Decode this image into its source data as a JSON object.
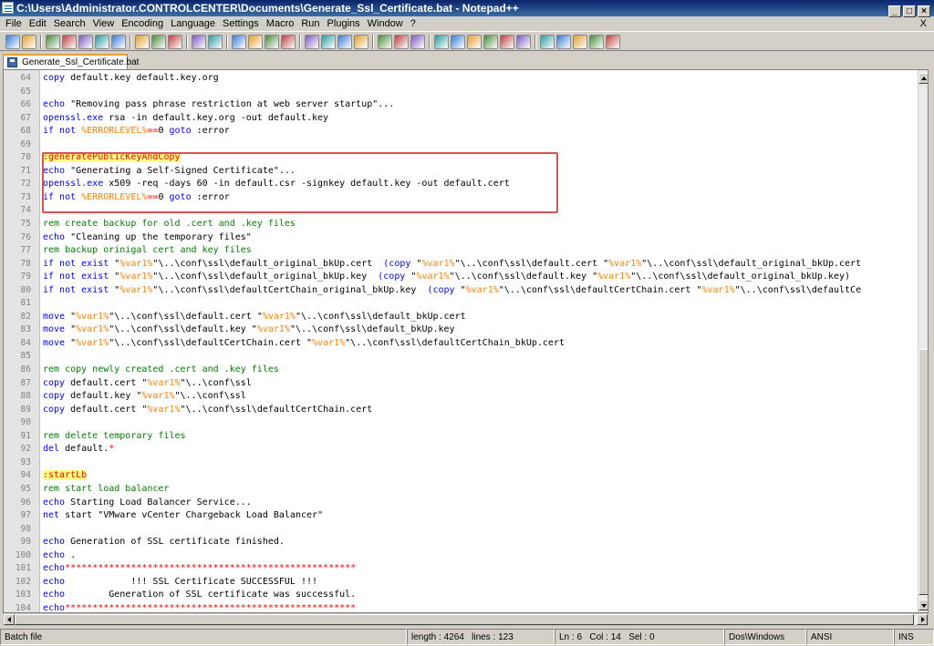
{
  "window": {
    "title": "C:\\Users\\Administrator.CONTROLCENTER\\Documents\\Generate_Ssl_Certificate.bat - Notepad++"
  },
  "menu": [
    "File",
    "Edit",
    "Search",
    "View",
    "Encoding",
    "Language",
    "Settings",
    "Macro",
    "Run",
    "Plugins",
    "Window",
    "?"
  ],
  "menu_close": "X",
  "toolbar": {
    "buttons": [
      "new",
      "open",
      "save",
      "save-all",
      "close",
      "close-all",
      "print",
      "cut",
      "copy",
      "paste",
      "undo",
      "redo",
      "find",
      "replace",
      "zoom-in",
      "zoom-out",
      "sync-vertical",
      "sync-horizontal",
      "word-wrap",
      "show-all-chars",
      "indent-guide",
      "user-lang",
      "doc-map",
      "record-macro",
      "stop-record",
      "play-macro",
      "play-multiple",
      "save-macro",
      "run",
      "trim",
      "move-up",
      "move-down",
      "hex",
      "spellcheck"
    ]
  },
  "tab": {
    "label": "Generate_Ssl_Certificate.bat"
  },
  "editor": {
    "lines": [
      {
        "n": "64",
        "t": [
          [
            "kw",
            "copy"
          ],
          [
            "",
            "default.key default.key.org"
          ]
        ]
      },
      {
        "n": "65",
        "t": []
      },
      {
        "n": "66",
        "t": [
          [
            "kw",
            "echo"
          ],
          [
            "",
            "\"Removing pass phrase restriction at web server startup\"..."
          ]
        ]
      },
      {
        "n": "67",
        "t": [
          [
            "kw",
            "openssl.exe"
          ],
          [
            "",
            "rsa -in default.key.org -out default.key"
          ]
        ]
      },
      {
        "n": "68",
        "t": [
          [
            "kw",
            "if not"
          ],
          [
            "var",
            "%ERRORLEVEL%"
          ],
          [
            "op",
            "=="
          ],
          [
            "",
            "0"
          ],
          [
            "kw",
            "goto"
          ],
          [
            "",
            ":error"
          ]
        ]
      },
      {
        "n": "69",
        "t": []
      },
      {
        "n": "70",
        "t": [
          [
            "lbl",
            ":generatePublicKeyAndCopy"
          ]
        ]
      },
      {
        "n": "71",
        "t": [
          [
            "kw",
            "echo"
          ],
          [
            "",
            "\"Generating a Self-Signed Certificate\"..."
          ]
        ]
      },
      {
        "n": "72",
        "t": [
          [
            "kw",
            "openssl.exe"
          ],
          [
            "",
            "x509 -req -days 60 -in default.csr -signkey default.key -out default.cert"
          ]
        ]
      },
      {
        "n": "73",
        "t": [
          [
            "kw",
            "if not"
          ],
          [
            "var",
            "%ERRORLEVEL%"
          ],
          [
            "op",
            "=="
          ],
          [
            "",
            "0"
          ],
          [
            "kw",
            "goto"
          ],
          [
            "",
            ":error"
          ]
        ]
      },
      {
        "n": "74",
        "t": []
      },
      {
        "n": "75",
        "t": [
          [
            "cm",
            "rem create backup for old .cert and .key files"
          ]
        ]
      },
      {
        "n": "76",
        "t": [
          [
            "kw",
            "echo"
          ],
          [
            "",
            "\"Cleaning up the temporary files\""
          ]
        ]
      },
      {
        "n": "77",
        "t": [
          [
            "cm",
            "rem backup orinigal cert and key files"
          ]
        ]
      },
      {
        "n": "78",
        "t": [
          [
            "kw",
            "if not exist"
          ],
          [
            "",
            "\""
          ],
          [
            "var",
            "%var1%"
          ],
          [
            "",
            "\"\\..\\conf\\ssl\\default_original_bkUp.cert "
          ],
          [
            "kw",
            "(copy"
          ],
          [
            "",
            "\""
          ],
          [
            "var",
            "%var1%"
          ],
          [
            "",
            "\"\\..\\conf\\ssl\\default.cert \""
          ],
          [
            "var",
            "%var1%"
          ],
          [
            "",
            "\"\\..\\conf\\ssl\\default_original_bkUp.cert"
          ]
        ]
      },
      {
        "n": "79",
        "t": [
          [
            "kw",
            "if not exist"
          ],
          [
            "",
            "\""
          ],
          [
            "var",
            "%var1%"
          ],
          [
            "",
            "\"\\..\\conf\\ssl\\default_original_bkUp.key "
          ],
          [
            "kw",
            "(copy"
          ],
          [
            "",
            "\""
          ],
          [
            "var",
            "%var1%"
          ],
          [
            "",
            "\"\\..\\conf\\ssl\\default.key \""
          ],
          [
            "var",
            "%var1%"
          ],
          [
            "",
            "\"\\..\\conf\\ssl\\default_original_bkUp.key)"
          ]
        ]
      },
      {
        "n": "80",
        "t": [
          [
            "kw",
            "if not exist"
          ],
          [
            "",
            "\""
          ],
          [
            "var",
            "%var1%"
          ],
          [
            "",
            "\"\\..\\conf\\ssl\\defaultCertChain_original_bkUp.key "
          ],
          [
            "kw",
            "(copy"
          ],
          [
            "",
            "\""
          ],
          [
            "var",
            "%var1%"
          ],
          [
            "",
            "\"\\..\\conf\\ssl\\defaultCertChain.cert \""
          ],
          [
            "var",
            "%var1%"
          ],
          [
            "",
            "\"\\..\\conf\\ssl\\defaultCe"
          ]
        ]
      },
      {
        "n": "81",
        "t": []
      },
      {
        "n": "82",
        "t": [
          [
            "kw",
            "move"
          ],
          [
            "",
            "\""
          ],
          [
            "var",
            "%var1%"
          ],
          [
            "",
            "\"\\..\\conf\\ssl\\default.cert \""
          ],
          [
            "var",
            "%var1%"
          ],
          [
            "",
            "\"\\..\\conf\\ssl\\default_bkUp.cert"
          ]
        ]
      },
      {
        "n": "83",
        "t": [
          [
            "kw",
            "move"
          ],
          [
            "",
            "\""
          ],
          [
            "var",
            "%var1%"
          ],
          [
            "",
            "\"\\..\\conf\\ssl\\default.key \""
          ],
          [
            "var",
            "%var1%"
          ],
          [
            "",
            "\"\\..\\conf\\ssl\\default_bkUp.key"
          ]
        ]
      },
      {
        "n": "84",
        "t": [
          [
            "kw",
            "move"
          ],
          [
            "",
            "\""
          ],
          [
            "var",
            "%var1%"
          ],
          [
            "",
            "\"\\..\\conf\\ssl\\defaultCertChain.cert \""
          ],
          [
            "var",
            "%var1%"
          ],
          [
            "",
            "\"\\..\\conf\\ssl\\defaultCertChain_bkUp.cert"
          ]
        ]
      },
      {
        "n": "85",
        "t": []
      },
      {
        "n": "86",
        "t": [
          [
            "cm",
            "rem copy newly created .cert and .key files"
          ]
        ]
      },
      {
        "n": "87",
        "t": [
          [
            "kw",
            "copy"
          ],
          [
            "",
            "default.cert \""
          ],
          [
            "var",
            "%var1%"
          ],
          [
            "",
            "\"\\..\\conf\\ssl"
          ]
        ]
      },
      {
        "n": "88",
        "t": [
          [
            "kw",
            "copy"
          ],
          [
            "",
            "default.key \""
          ],
          [
            "var",
            "%var1%"
          ],
          [
            "",
            "\"\\..\\conf\\ssl"
          ]
        ]
      },
      {
        "n": "89",
        "t": [
          [
            "kw",
            "copy"
          ],
          [
            "",
            "default.cert \""
          ],
          [
            "var",
            "%var1%"
          ],
          [
            "",
            "\"\\..\\conf\\ssl\\defaultCertChain.cert"
          ]
        ]
      },
      {
        "n": "90",
        "t": []
      },
      {
        "n": "91",
        "t": [
          [
            "cm",
            "rem delete temporary files"
          ]
        ]
      },
      {
        "n": "92",
        "t": [
          [
            "kw",
            "del"
          ],
          [
            "",
            "default."
          ],
          [
            "op",
            "*"
          ]
        ]
      },
      {
        "n": "93",
        "t": []
      },
      {
        "n": "94",
        "t": [
          [
            "lbl",
            ":startLb"
          ]
        ]
      },
      {
        "n": "95",
        "t": [
          [
            "cm",
            "rem start load balancer"
          ]
        ]
      },
      {
        "n": "96",
        "t": [
          [
            "kw",
            "echo"
          ],
          [
            "",
            "Starting Load Balancer Service..."
          ]
        ]
      },
      {
        "n": "97",
        "t": [
          [
            "kw",
            "net"
          ],
          [
            "",
            "start \"VMware vCenter Chargeback Load Balancer\""
          ]
        ]
      },
      {
        "n": "98",
        "t": []
      },
      {
        "n": "99",
        "t": [
          [
            "kw",
            "echo"
          ],
          [
            "",
            "Generation of SSL certificate finished."
          ]
        ]
      },
      {
        "n": "100",
        "t": [
          [
            "kw",
            "echo"
          ],
          [
            "",
            "."
          ]
        ]
      },
      {
        "n": "101",
        "t": [
          [
            "kw",
            "echo"
          ],
          [
            "op",
            "*****************************************************"
          ]
        ]
      },
      {
        "n": "102",
        "t": [
          [
            "kw",
            "echo"
          ],
          [
            "",
            "           !!! SSL Certificate SUCCESSFUL !!!"
          ]
        ]
      },
      {
        "n": "103",
        "t": [
          [
            "kw",
            "echo"
          ],
          [
            "",
            "       Generation of SSL certificate was successful."
          ]
        ]
      },
      {
        "n": "104",
        "t": [
          [
            "kw",
            "echo"
          ],
          [
            "op",
            "*****************************************************"
          ]
        ]
      }
    ]
  },
  "status": {
    "type": "Batch file",
    "length": "length : 4264",
    "lines": "lines : 123",
    "ln": "Ln : 6",
    "col": "Col : 14",
    "sel": "Sel : 0",
    "eol": "Dos\\Windows",
    "encoding": "ANSI",
    "mode": "INS"
  },
  "colors": {
    "highlight_box": "#e05050",
    "keyword": "#0000ff",
    "comment": "#008000",
    "variable": "#ff8000",
    "label_bg": "#ffff80"
  }
}
